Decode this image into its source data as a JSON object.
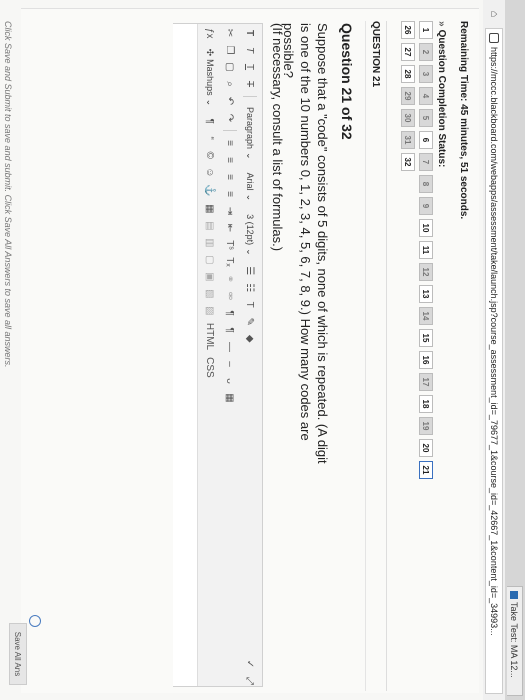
{
  "browser": {
    "tab_title": "Take Test: MA 12...",
    "url": "https://mccc.blackboard.com/webapps/assessment/take/launch.jsp?course_assessment_id=_79677_1&course_id=_42667_1&content_id=_34993..."
  },
  "test": {
    "remaining_label": "Remaining Time: 45 minutes, 51 seconds.",
    "status_title": "Question Completion Status:",
    "question_rows": [
      [
        {
          "n": "1",
          "state": "plain"
        },
        {
          "n": "2",
          "state": "answered"
        },
        {
          "n": "3",
          "state": "answered"
        },
        {
          "n": "4",
          "state": "answered"
        },
        {
          "n": "5",
          "state": "answered"
        },
        {
          "n": "6",
          "state": "plain"
        },
        {
          "n": "7",
          "state": "answered"
        },
        {
          "n": "8",
          "state": "answered"
        },
        {
          "n": "9",
          "state": "answered"
        },
        {
          "n": "10",
          "state": "plain"
        },
        {
          "n": "11",
          "state": "plain"
        },
        {
          "n": "12",
          "state": "answered"
        },
        {
          "n": "13",
          "state": "plain"
        },
        {
          "n": "14",
          "state": "answered"
        },
        {
          "n": "15",
          "state": "plain"
        },
        {
          "n": "16",
          "state": "plain"
        },
        {
          "n": "17",
          "state": "answered"
        },
        {
          "n": "18",
          "state": "plain"
        },
        {
          "n": "19",
          "state": "answered"
        },
        {
          "n": "20",
          "state": "plain"
        },
        {
          "n": "21",
          "state": "current"
        }
      ],
      [
        {
          "n": "26",
          "state": "plain"
        },
        {
          "n": "27",
          "state": "plain"
        },
        {
          "n": "28",
          "state": "plain"
        },
        {
          "n": "29",
          "state": "answered"
        },
        {
          "n": "30",
          "state": "answered"
        },
        {
          "n": "31",
          "state": "answered"
        },
        {
          "n": "32",
          "state": "plain"
        }
      ]
    ],
    "question_header": "QUESTION 21",
    "question_title": "Question 21 of 32",
    "question_text": "Suppose that a \"code\" consists of 5 digits, none of which is repeated. (A digit is one of the 10 numbers 0, 1, 2, 3, 4, 5, 6, 7, 8, 9.) How many codes are possible?",
    "question_hint": "(If necessary, consult a list of formulas.)",
    "editor": {
      "paragraph_label": "Paragraph",
      "font_label": "Arial",
      "size_label": "3 (12pt)",
      "mashups_label": "Mashups",
      "html_label": "HTML",
      "css_label": "CSS"
    },
    "footer_text": "Click Save and Submit to save and submit. Click Save All Answers to save all answers.",
    "save_all_label": "Save All Ans"
  }
}
